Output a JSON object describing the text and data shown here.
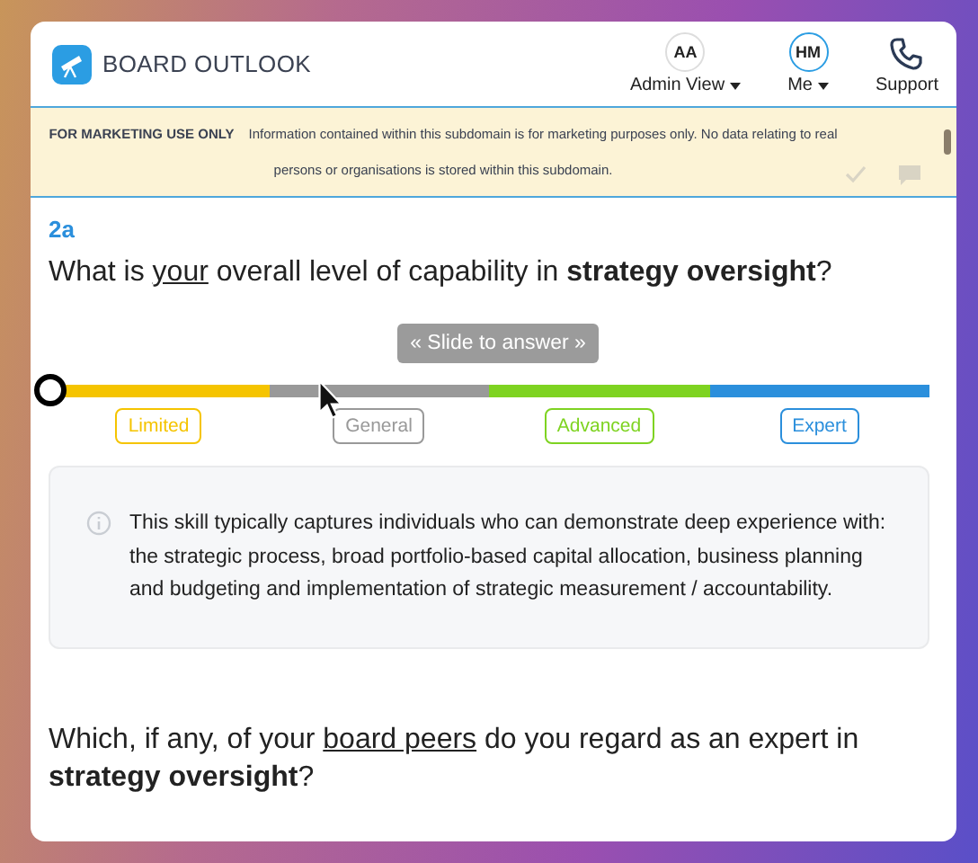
{
  "header": {
    "brand": "BOARD OUTLOOK",
    "nav": [
      {
        "kind": "avatar",
        "initials": "AA",
        "label": "Admin View",
        "selected": false
      },
      {
        "kind": "avatar",
        "initials": "HM",
        "label": "Me",
        "selected": true
      },
      {
        "kind": "phone",
        "label": "Support"
      }
    ]
  },
  "banner": {
    "tag": "FOR MARKETING USE ONLY",
    "message": "Information contained within this subdomain is for marketing purposes only. No data relating to real persons or organisations is stored within this subdomain."
  },
  "question": {
    "number": "2a",
    "text": [
      {
        "kind": "plain",
        "text": "What is "
      },
      {
        "kind": "underline",
        "text": "your"
      },
      {
        "kind": "plain",
        "text": " overall level of capability in "
      },
      {
        "kind": "bold",
        "text": "strategy oversight"
      },
      {
        "kind": "plain",
        "text": "?"
      }
    ],
    "hint": "« Slide to answer »",
    "slider": {
      "level": 0
    },
    "options": [
      {
        "label": "Limited",
        "color": "#f5c400"
      },
      {
        "label": "General",
        "color": "#999999"
      },
      {
        "label": "Advanced",
        "color": "#7ed321"
      },
      {
        "label": "Expert",
        "color": "#2b8fdc"
      }
    ],
    "info": "This skill typically captures individuals who can demonstrate deep experience with: the strategic process, broad portfolio-based capital allocation, business planning and budgeting and implementation of strategic measurement / accountability."
  },
  "next_question": {
    "text": [
      {
        "kind": "plain",
        "text": "Which, if any, of your "
      },
      {
        "kind": "underline",
        "text": "board peers"
      },
      {
        "kind": "plain",
        "text": " do you regard as an expert in "
      },
      {
        "kind": "bold",
        "text": "strategy oversight"
      },
      {
        "kind": "plain",
        "text": "?"
      }
    ]
  }
}
